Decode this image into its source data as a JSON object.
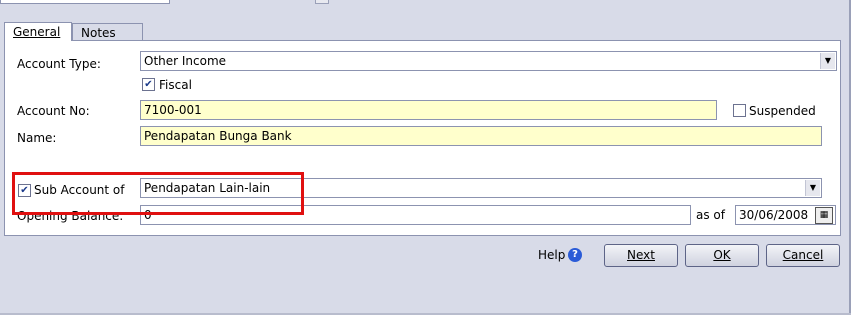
{
  "tabs": {
    "general": "General",
    "notes": "Notes"
  },
  "form": {
    "account_type_label": "Account Type:",
    "account_type_value": "Other Income",
    "fiscal_label": "Fiscal",
    "fiscal_checked": true,
    "account_no_label": "Account No:",
    "account_no_value": "7100-001",
    "suspended_label": "Suspended",
    "suspended_checked": false,
    "name_label": "Name:",
    "name_value": "Pendapatan Bunga Bank",
    "sub_account_label": "Sub Account of",
    "sub_account_checked": true,
    "sub_account_value": "Pendapatan Lain-lain",
    "opening_balance_label": "Opening Balance:",
    "opening_balance_value": "0",
    "as_of_label": "as of",
    "as_of_date": "30/06/2008"
  },
  "buttons": {
    "help": "Help",
    "next": "Next",
    "ok": "OK",
    "cancel": "Cancel"
  },
  "colors": {
    "required_field_bg": "#ffffcc",
    "highlight_border": "#e01010",
    "help_icon": "#2a5bd7"
  },
  "icons": {
    "dropdown": "chevron-down-icon",
    "calendar": "calendar-icon",
    "help": "help-question-icon",
    "check": "checkmark-icon"
  }
}
